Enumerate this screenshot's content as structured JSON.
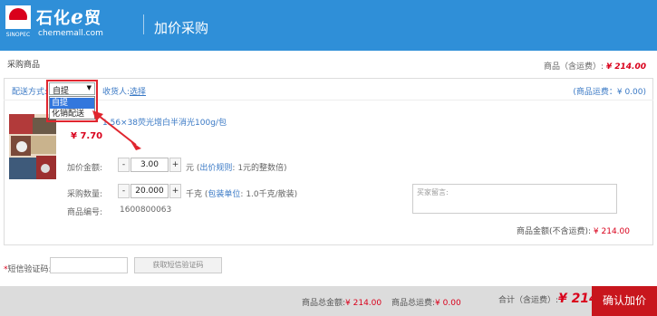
{
  "header": {
    "brand_name_prefix": "石化",
    "brand_e": "e",
    "brand_name_suffix": "贸",
    "domain": "chememall.com",
    "page_title": "加价采购",
    "logo_text": "SINOPEC"
  },
  "section": {
    "title": "采购商品",
    "total_label": "商品（含运费）:",
    "total_value": "¥ 214.00"
  },
  "shipping": {
    "label": "配送方式:",
    "selected": "自提",
    "options": [
      "自提",
      "化销配送"
    ],
    "receiver_label": "收货人:",
    "receiver_link": "选择",
    "fee_text": "(商品运费：¥ 0.00)"
  },
  "product": {
    "name": "1.56×38荧光增白半消光100g/包",
    "price": "¥ 7.70",
    "markup_label": "加价金额:",
    "markup_value": "3.00",
    "markup_unit": "元",
    "markup_rule_open": "(",
    "markup_rule_link": "出价规则",
    "markup_rule_text": ": 1元的整数倍)",
    "qty_label": "采购数量:",
    "qty_value": "20.000",
    "qty_unit": "千克",
    "pack_open": "(",
    "pack_link": "包装单位",
    "pack_text": ": 1.0千克/散装)",
    "code_label": "商品编号:",
    "code_value": "1600800063"
  },
  "message": {
    "placeholder": "买家留言:"
  },
  "amount": {
    "label": "商品金额(不含运费):",
    "value": "¥ 214.00"
  },
  "sms": {
    "star": "*",
    "label": "短信验证码:",
    "button": "获取短信验证码"
  },
  "footer": {
    "goods_total_label": "商品总金额:",
    "goods_total_value": "¥ 214.00",
    "fee_total_label": "商品总运费:",
    "fee_total_value": "¥ 0.00",
    "grand_label": "合计（含运费）:",
    "grand_value": "¥ 214.00",
    "confirm_button": "确认加价"
  },
  "colors": {
    "header_bg": "#2f8fd8",
    "price_red": "#d9001b",
    "link_blue": "#3a79c5",
    "confirm_bg": "#c8161d",
    "highlight": "#e0262f"
  },
  "icons": {
    "select_arrow": "chevron-down-icon",
    "stepper_minus": "minus-icon",
    "stepper_plus": "plus-icon"
  }
}
